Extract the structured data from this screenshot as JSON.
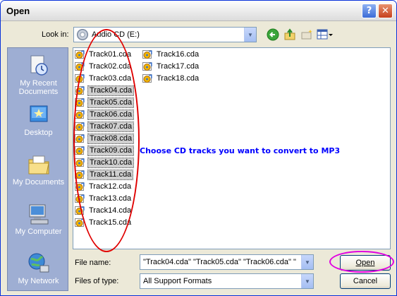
{
  "window": {
    "title": "Open"
  },
  "titlebar": {
    "help_symbol": "?",
    "close_symbol": "✕"
  },
  "toolbar": {
    "look_in_label": "Look in:",
    "look_in_value": "Audio CD (E:)",
    "icons": [
      "back-icon",
      "up-folder-icon",
      "new-folder-icon",
      "views-menu-icon"
    ]
  },
  "places": [
    {
      "label": "My Recent Documents",
      "icon": "recent-documents-icon"
    },
    {
      "label": "Desktop",
      "icon": "desktop-icon"
    },
    {
      "label": "My Documents",
      "icon": "my-documents-icon"
    },
    {
      "label": "My Computer",
      "icon": "my-computer-icon"
    },
    {
      "label": "My Network",
      "icon": "my-network-icon"
    }
  ],
  "files": {
    "column1": [
      "Track01.cda",
      "Track02.cda",
      "Track03.cda",
      "Track04.cda",
      "Track05.cda",
      "Track06.cda",
      "Track07.cda",
      "Track08.cda",
      "Track09.cda",
      "Track10.cda",
      "Track11.cda",
      "Track12.cda",
      "Track13.cda",
      "Track14.cda",
      "Track15.cda"
    ],
    "column2": [
      "Track16.cda",
      "Track17.cda",
      "Track18.cda"
    ],
    "selected": [
      "Track04.cda",
      "Track05.cda",
      "Track06.cda",
      "Track07.cda",
      "Track08.cda",
      "Track09.cda",
      "Track10.cda",
      "Track11.cda"
    ]
  },
  "annotation": {
    "hint": "Choose CD tracks you want to convert to MP3"
  },
  "form": {
    "file_name_label": "File name:",
    "file_name_value": "\"Track04.cda\" \"Track05.cda\" \"Track06.cda\" \"",
    "files_of_type_label": "Files of type:",
    "files_of_type_value": "All Support Formats"
  },
  "buttons": {
    "open": "Open",
    "cancel": "Cancel"
  },
  "colors": {
    "annotation_red": "#e00000",
    "annotation_magenta": "#e000e0",
    "hint_blue": "#0000ff",
    "places_bar": "#9eaed3"
  }
}
